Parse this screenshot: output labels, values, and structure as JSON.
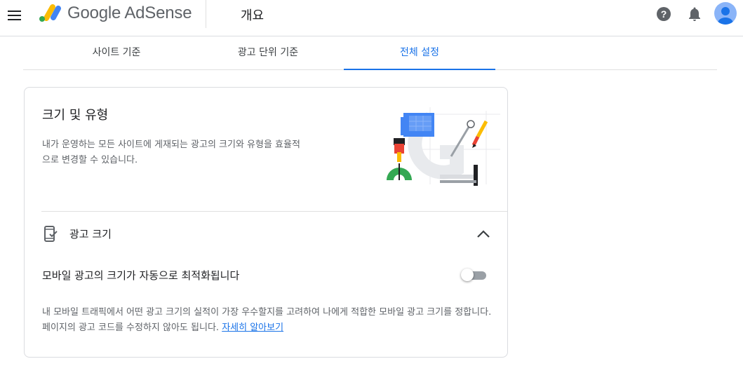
{
  "header": {
    "brand": "Google AdSense",
    "page_title": "개요"
  },
  "tabs": [
    {
      "label": "사이트 기준",
      "active": false
    },
    {
      "label": "광고 단위 기준",
      "active": false
    },
    {
      "label": "전체 설정",
      "active": true
    }
  ],
  "card": {
    "title": "크기 및 유형",
    "description": "내가 운영하는 모든 사이트에 게재되는 광고의 크기와 유형을 효율적으로 변경할 수 있습니다.",
    "section": {
      "icon": "phone-check-icon",
      "title": "광고 크기",
      "expanded": true
    },
    "setting": {
      "label": "모바일 광고의 크기가 자동으로 최적화됩니다",
      "enabled": false,
      "description": "내 모바일 트래픽에서 어떤 광고 크기의 실적이 가장 우수할지를 고려하여 나에게 적합한 모바일 광고 크기를 정합니다. 페이지의 광고 코드를 수정하지 않아도 됩니다.",
      "link_text": "자세히 알아보기"
    }
  },
  "colors": {
    "accent": "#1a73e8",
    "divider": "#dadce0",
    "logo_yellow": "#fbbc04",
    "logo_blue": "#4285f4",
    "logo_green": "#34a853"
  }
}
